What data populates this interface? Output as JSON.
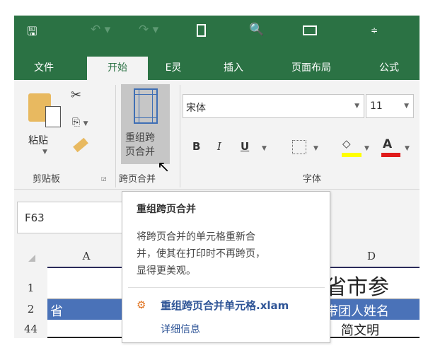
{
  "quick_access": {
    "save": "save-icon",
    "undo": "undo-icon",
    "redo": "redo-icon",
    "new": "new-document-icon",
    "print_preview": "print-preview-icon",
    "open": "open-folder-icon",
    "customize": "customize-icon"
  },
  "tabs": [
    {
      "label": "文件"
    },
    {
      "label": "开始",
      "active": true
    },
    {
      "label": "E灵"
    },
    {
      "label": "插入"
    },
    {
      "label": "页面布局"
    },
    {
      "label": "公式"
    }
  ],
  "ribbon": {
    "clipboard": {
      "paste": "粘贴",
      "group": "剪贴板"
    },
    "merge": {
      "button": "重组跨\n页合并",
      "line1": "重组跨",
      "line2": "页合并",
      "group": "跨页合并"
    },
    "font": {
      "name": "宋体",
      "size": "11",
      "bold": "B",
      "italic": "I",
      "underline": "U",
      "font_color": "A",
      "group": "字体"
    },
    "colors": {
      "highlight": "#ffff00",
      "font_color": "#e01b1b",
      "green": "#2b7244"
    }
  },
  "name_box": "F63",
  "columns": [
    "A",
    "D"
  ],
  "rows": [
    {
      "num": "1",
      "a": "",
      "d": "省市参"
    },
    {
      "num": "2",
      "a": "省",
      "d": "带团人姓名"
    },
    {
      "num": "44",
      "a": "",
      "d": "简文明"
    }
  ],
  "tooltip": {
    "title": "重组跨页合并",
    "description": "将跨页合并的单元格重新合并，使其在打印时不再跨页，显得更美观。",
    "desc_lines": [
      "将跨页合并的单元格重新合",
      "并，使其在打印时不再跨页，",
      "显得更美观。"
    ],
    "addin": "重组跨页合并单元格.xlam",
    "more": "详细信息"
  }
}
